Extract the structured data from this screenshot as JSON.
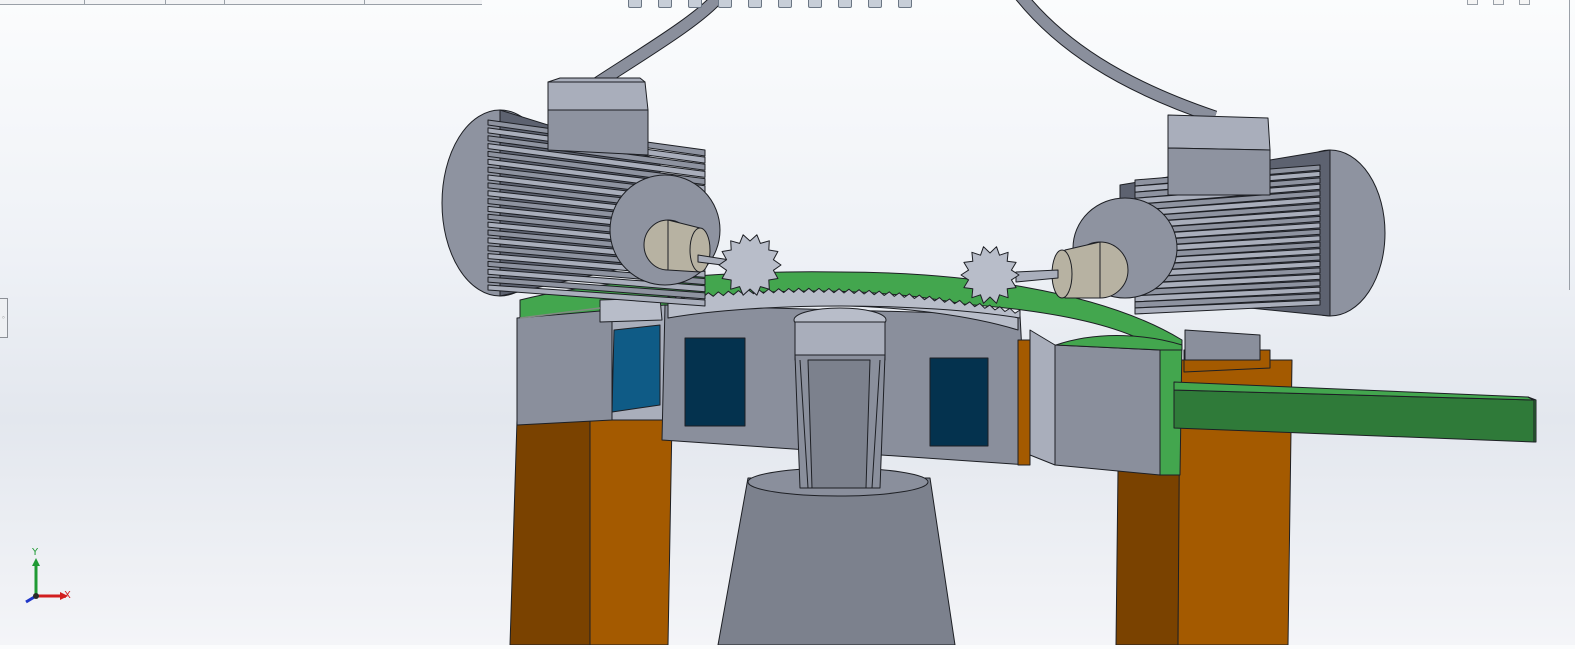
{
  "window": {
    "app": "CAD viewport",
    "background_top": "#fbfcfd",
    "background_mid": "#e3e7ee"
  },
  "heads_up_toolbar": {
    "icons": [
      "zoom-to-fit-icon",
      "zoom-area-icon",
      "previous-view-icon",
      "section-view-icon",
      "view-orientation-icon",
      "display-style-icon",
      "hide-show-items-icon",
      "edit-appearance-icon",
      "apply-scene-icon",
      "view-settings-icon"
    ]
  },
  "window_controls": {
    "icons": [
      "restore-icon",
      "tile-icon",
      "close-icon"
    ]
  },
  "triad": {
    "y_label": "Y",
    "x_label": "X",
    "y_color": "#1f9a34",
    "x_color": "#d21f1f",
    "z_color": "#1f36c8"
  },
  "model": {
    "colors": {
      "motor_body": "#8e93a0",
      "motor_dark": "#5d6270",
      "motor_light": "#a9aebb",
      "coupling": "#b7b2a2",
      "turntable_green": "#43a64e",
      "frame_dark_green": "#2f7a39",
      "gear_grey": "#b8bdc9",
      "housing_grey": "#8a8f9c",
      "window_blue": "#0f5b86",
      "window_dark": "#04324e",
      "leg_orange_light": "#a45a00",
      "leg_orange_dark": "#7a4200",
      "pedestal": "#7c818d",
      "cable": "#8a8f9c"
    }
  }
}
